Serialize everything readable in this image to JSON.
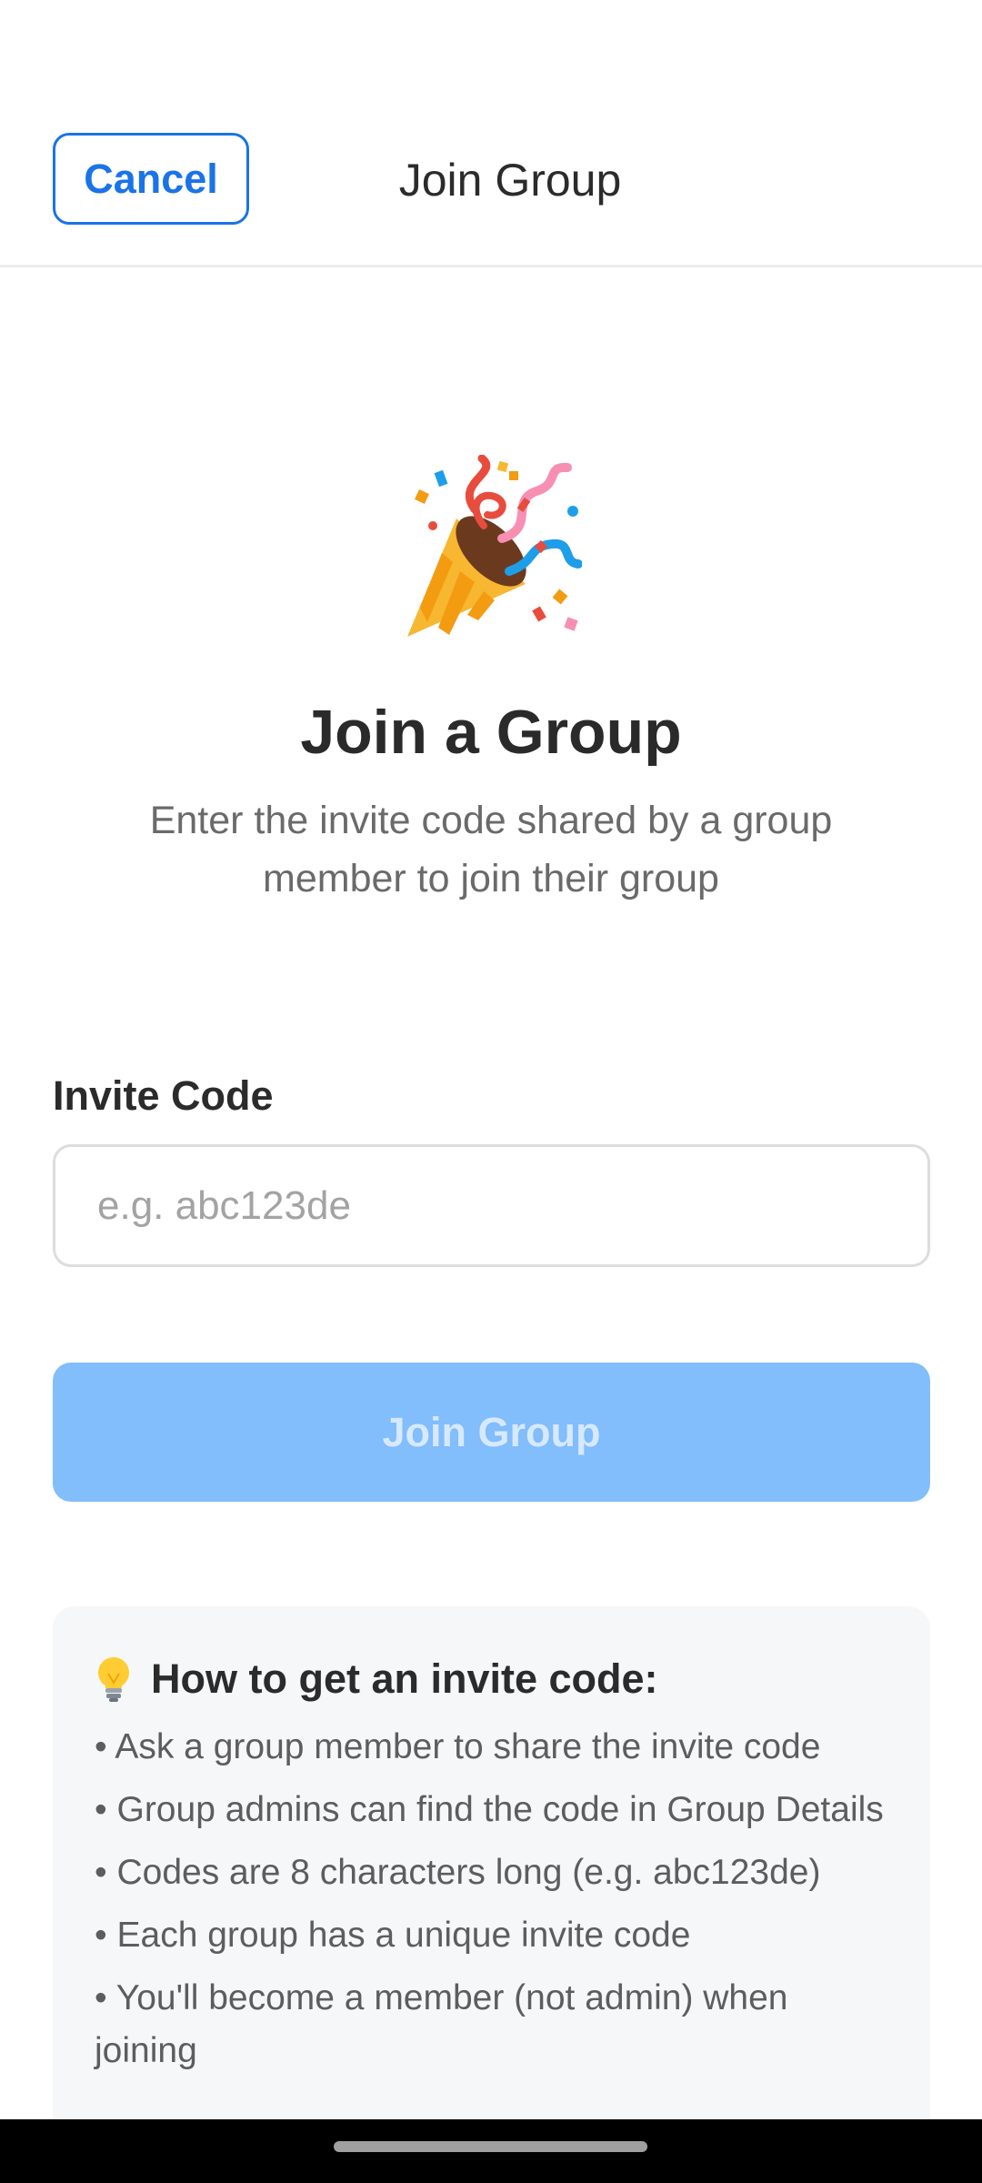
{
  "header": {
    "cancel_label": "Cancel",
    "title": "Join Group"
  },
  "hero": {
    "icon": "party-popper-icon",
    "title": "Join a Group",
    "subtitle": "Enter the invite code shared by a group member to join their group"
  },
  "form": {
    "invite_label": "Invite Code",
    "invite_value": "",
    "invite_placeholder": "e.g. abc123de",
    "submit_label": "Join Group",
    "submit_disabled": true
  },
  "tips": {
    "icon": "light-bulb-icon",
    "heading": "How to get an invite code:",
    "items": [
      "• Ask a group member to share the invite code",
      "• Group admins can find the code in Group Details",
      "• Codes are 8 characters long (e.g. abc123de)",
      "• Each group has a unique invite code",
      "• You'll become a member (not admin) when joining"
    ]
  },
  "colors": {
    "accent": "#1a73e8",
    "disabled_button": "#82bdfc",
    "card_background": "#f6f7f9"
  }
}
